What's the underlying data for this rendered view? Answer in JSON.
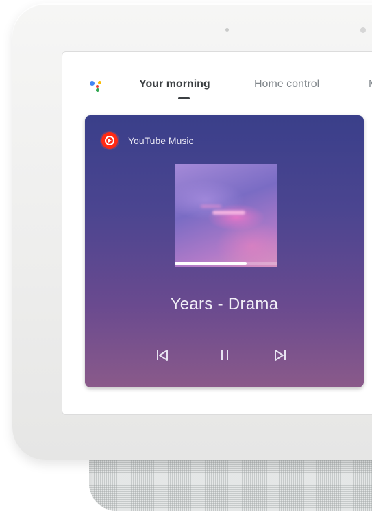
{
  "assistant": {
    "icon": "google-assistant-icon",
    "colors": [
      "#4285F4",
      "#EA4335",
      "#FBBC05",
      "#34A853"
    ]
  },
  "tabs": [
    {
      "label": "Your morning",
      "active": true
    },
    {
      "label": "Home control",
      "active": false
    },
    {
      "label": "Mo",
      "active": false
    }
  ],
  "media": {
    "source_label": "YouTube Music",
    "source_icon": "youtube-music-icon",
    "track_title": "Years - Drama",
    "progress": 0.7,
    "controls": {
      "previous_icon": "skip-previous-icon",
      "pause_icon": "pause-icon",
      "next_icon": "skip-next-icon"
    },
    "accent_color": "#ff2a14"
  }
}
